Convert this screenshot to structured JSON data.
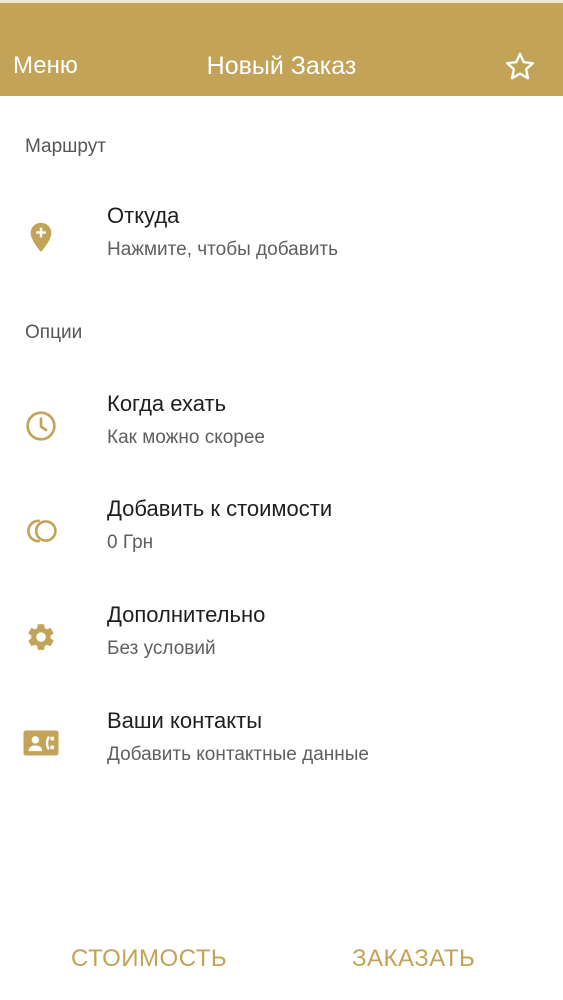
{
  "header": {
    "menu_label": "Меню",
    "title": "Новый Заказ",
    "favorite_icon": "star-outline-icon"
  },
  "route": {
    "section_title": "Маршрут",
    "from": {
      "label": "Откуда",
      "sub": "Нажмите, чтобы добавить",
      "icon": "location-pin-plus-icon"
    }
  },
  "options": {
    "section_title": "Опции",
    "items": [
      {
        "label": "Когда ехать",
        "sub": "Как можно скорее",
        "icon": "clock-icon"
      },
      {
        "label": "Добавить к стоимости",
        "sub": "0 Грн",
        "icon": "coins-icon"
      },
      {
        "label": "Дополнительно",
        "sub": "Без условий",
        "icon": "gear-icon"
      },
      {
        "label": "Ваши контакты",
        "sub": "Добавить контактные данные",
        "icon": "contact-card-icon"
      }
    ]
  },
  "footer": {
    "cost_label": "СТОИМОСТЬ",
    "order_label": "ЗАКАЗАТЬ"
  },
  "colors": {
    "accent": "#c2a358",
    "text_primary": "#1e1e1e",
    "text_secondary": "#5f5f5f",
    "background": "#ffffff"
  }
}
